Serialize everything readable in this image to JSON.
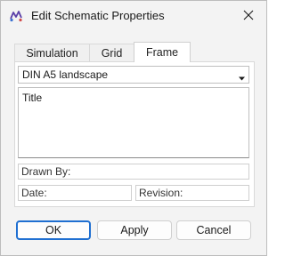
{
  "window": {
    "title": "Edit Schematic Properties",
    "icon": "schematic-app-icon",
    "close_icon": "close-icon"
  },
  "tabs": [
    {
      "label": "Simulation",
      "selected": false
    },
    {
      "label": "Grid",
      "selected": false
    },
    {
      "label": "Frame",
      "selected": true
    }
  ],
  "frame": {
    "size_select": {
      "value": "DIN A5 landscape",
      "icon": "chevron-down-icon"
    },
    "title_field": {
      "value": "Title"
    },
    "drawn_by_field": {
      "value": "Drawn By:"
    },
    "date_field": {
      "value": "Date:"
    },
    "revision_field": {
      "value": "Revision:"
    }
  },
  "buttons": {
    "ok": "OK",
    "apply": "Apply",
    "cancel": "Cancel"
  },
  "colors": {
    "accent": "#1f6fd1",
    "dialog_background": "#f3f3f3"
  }
}
